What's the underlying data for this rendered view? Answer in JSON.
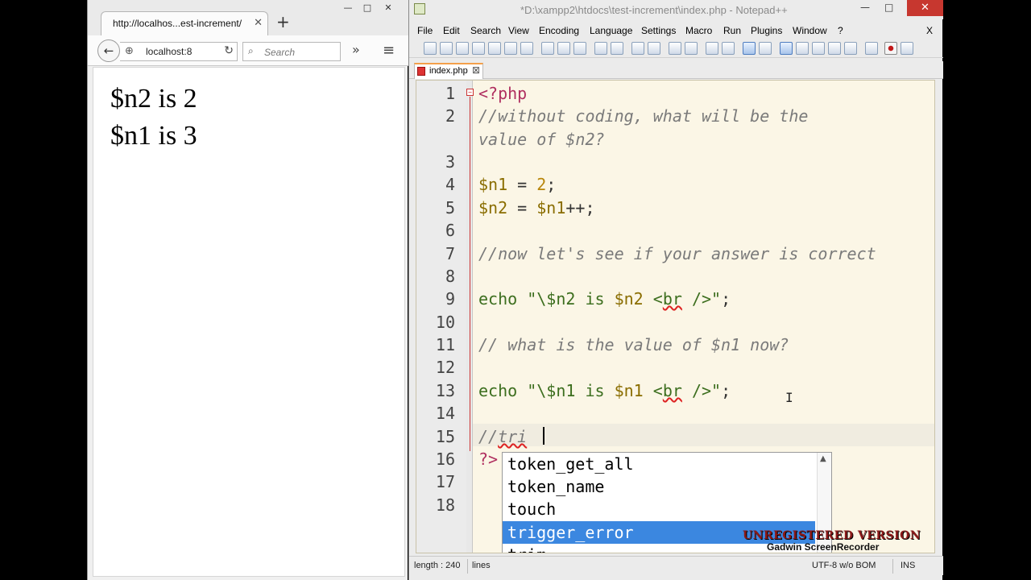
{
  "firefox": {
    "tab_title": "http://localhos...est-increment/",
    "tab_close": "✕",
    "new_tab": "+",
    "url": "localhost:8",
    "search_placeholder": "Search",
    "page_lines": [
      "$n2 is 2",
      "$n1 is 3"
    ],
    "window_controls": [
      "—",
      "□",
      "✕"
    ]
  },
  "notepad": {
    "title": "*D:\\xampp2\\htdocs\\test-increment\\index.php - Notepad++",
    "close_glyph": "✕",
    "min_glyph": "—",
    "max_glyph": "□",
    "menu": [
      "File",
      "Edit",
      "Search",
      "View",
      "Encoding",
      "Language",
      "Settings",
      "Macro",
      "Run",
      "Plugins",
      "Window",
      "?"
    ],
    "menu_close": "X",
    "tab_label": "index.php",
    "tab_close": "⊠",
    "line_numbers": [
      "1",
      "2",
      "3",
      "4",
      "5",
      "6",
      "7",
      "8",
      "9",
      "10",
      "11",
      "12",
      "13",
      "14",
      "15",
      "16",
      "17",
      "18"
    ],
    "code": {
      "l1": "<?php",
      "l2a": "//without coding, what will be the",
      "l2b": "value of $n2?",
      "l4_var": "$n1",
      "l4_op": " = ",
      "l4_num": "2",
      "l4_end": ";",
      "l5_var": "$n2",
      "l5_op": " = ",
      "l5_var2": "$n1",
      "l5_end": "++;",
      "l7": "//now let's see if your answer is correct",
      "l9_kw": "echo",
      "l9_s1": " \"\\$n2 is ",
      "l9_var": "$n2",
      "l9_s2": " <",
      "l9_br": "br",
      "l9_s3": " />\"",
      "l9_end": ";",
      "l11": "// what is the value of $n1 now?",
      "l13_kw": "echo",
      "l13_s1": " \"\\$n1 is ",
      "l13_var": "$n1",
      "l13_s2": " <",
      "l13_br": "br",
      "l13_s3": " />\"",
      "l13_end": ";",
      "l15_a": "//",
      "l15_b": "tri",
      "l16": "?>"
    },
    "autocomplete": [
      "token_get_all",
      "token_name",
      "touch",
      "trigger_error",
      "trim"
    ],
    "autocomplete_selected": "trigger_error",
    "status": {
      "length": "length : 240",
      "lines": "lines",
      "encoding": "UTF-8 w/o BOM",
      "mode": "INS"
    }
  },
  "watermark": {
    "line1": "UNREGISTERED VERSION",
    "line2": "Gadwin ScreenRecorder"
  },
  "colors": {
    "editor_bg": "#fbf6e6",
    "selection": "#3b87e0",
    "close_button": "#c7372f"
  }
}
